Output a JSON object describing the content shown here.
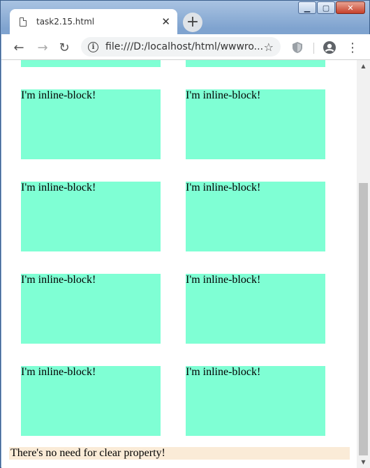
{
  "browser": {
    "tab_title": "task2.15.html",
    "tab_close_glyph": "✕",
    "new_tab_glyph": "+",
    "url": "file:///D:/localhost/html/wwwro...",
    "info_glyph": "i",
    "star_glyph": "☆",
    "back_glyph": "←",
    "forward_glyph": "→",
    "reload_glyph": "↻",
    "menu_glyph": "⋮",
    "window_minimize_glyph": "▁",
    "window_maximize_glyph": "▢",
    "window_close_glyph": "✕"
  },
  "page": {
    "block_color": "#7fffd4",
    "footer_color": "#faebd7",
    "blocks": [
      {
        "label": ""
      },
      {
        "label": ""
      },
      {
        "label": "I'm inline-block!"
      },
      {
        "label": "I'm inline-block!"
      },
      {
        "label": "I'm inline-block!"
      },
      {
        "label": "I'm inline-block!"
      },
      {
        "label": "I'm inline-block!"
      },
      {
        "label": "I'm inline-block!"
      },
      {
        "label": "I'm inline-block!"
      },
      {
        "label": "I'm inline-block!"
      }
    ],
    "footer_text": "There's no need for clear property!"
  },
  "icons": {
    "page": "document-icon",
    "extension": "shield-extension-icon",
    "profile": "account-circle-icon"
  }
}
